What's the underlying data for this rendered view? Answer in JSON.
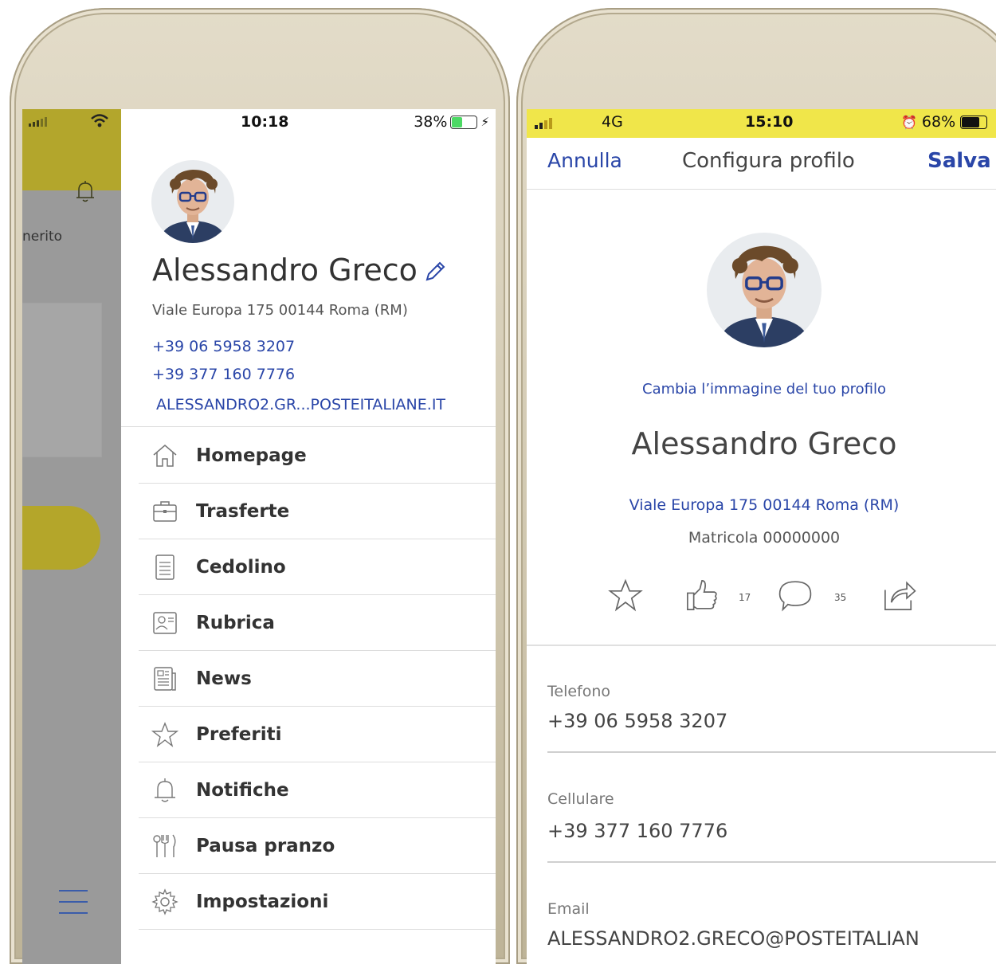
{
  "left_phone": {
    "background_app": {
      "snippet_text": "nerito"
    },
    "status": {
      "time": "10:18",
      "battery": "38%",
      "battery_level": 0.38
    },
    "profile": {
      "name": "Alessandro Greco",
      "address": "Viale Europa 175 00144 Roma (RM)",
      "phone": "+39 06 5958 3207",
      "mobile": "+39 377 160 7776",
      "email": "ALESSANDRO2.GR...POSTEITALIANE.IT"
    },
    "menu": [
      {
        "label": "Homepage",
        "icon": "home-icon"
      },
      {
        "label": "Trasferte",
        "icon": "briefcase-icon"
      },
      {
        "label": "Cedolino",
        "icon": "document-icon"
      },
      {
        "label": "Rubrica",
        "icon": "contact-card-icon"
      },
      {
        "label": "News",
        "icon": "newspaper-icon"
      },
      {
        "label": "Preferiti",
        "icon": "star-icon"
      },
      {
        "label": "Notifiche",
        "icon": "bell-icon"
      },
      {
        "label": "Pausa pranzo",
        "icon": "cutlery-icon"
      },
      {
        "label": "Impostazioni",
        "icon": "gear-icon"
      }
    ]
  },
  "right_phone": {
    "status": {
      "network": "4G",
      "time": "15:10",
      "battery": "68%",
      "battery_level": 0.68
    },
    "nav": {
      "cancel": "Annulla",
      "title": "Configura profilo",
      "save": "Salva"
    },
    "profile": {
      "change_photo": "Cambia l’immagine del tuo profilo",
      "name": "Alessandro Greco",
      "address": "Viale Europa 175 00144 Roma (RM)",
      "matricola": "Matricola 00000000"
    },
    "stats": {
      "likes": "17",
      "comments": "35"
    },
    "fields": [
      {
        "label": "Telefono",
        "value": "+39 06 5958 3207"
      },
      {
        "label": "Cellulare",
        "value": "+39 377 160 7776"
      },
      {
        "label": "Email",
        "value": "ALESSANDRO2.GRECO@POSTEITALIAN"
      }
    ]
  },
  "colors": {
    "accent_blue": "#2a46a8",
    "olive_yellow": "#b3a62c",
    "status_yellow": "#f0e64a",
    "gold_frame": "#cfc6ae"
  }
}
